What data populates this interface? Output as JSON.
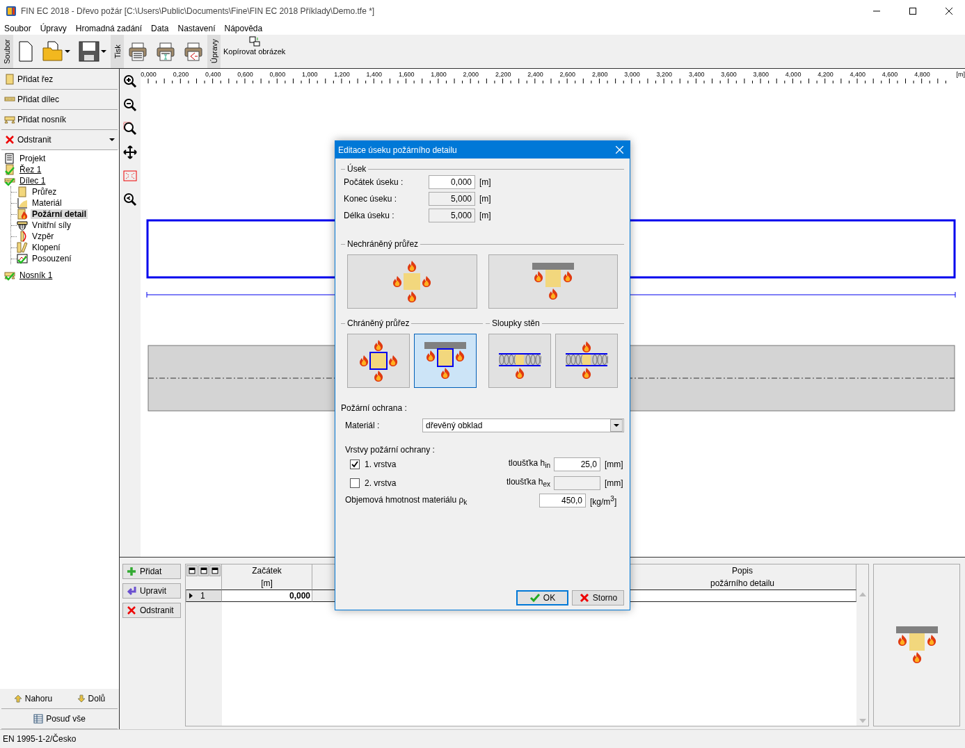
{
  "window": {
    "title": "FIN EC 2018 - Dřevo požár [C:\\Users\\Public\\Documents\\Fine\\FIN EC 2018 Příklady\\Demo.tfe *]"
  },
  "menu": [
    "Soubor",
    "Úpravy",
    "Hromadná zadání",
    "Data",
    "Nastavení",
    "Nápověda"
  ],
  "toolbar": {
    "groups": [
      {
        "kind": "file",
        "label": "Soubor"
      },
      {
        "kind": "print",
        "label": "Tisk"
      },
      {
        "kind": "edit",
        "label": "Úpravy",
        "button": "Kopírovat obrázek"
      }
    ]
  },
  "actions": [
    {
      "kind": "section",
      "label": "Přidat řez"
    },
    {
      "kind": "member",
      "label": "Přidat dílec"
    },
    {
      "kind": "beam",
      "label": "Přidat nosník"
    },
    {
      "kind": "remove",
      "label": "Odstranit"
    }
  ],
  "tree": [
    {
      "kind": "project",
      "label": "Projekt",
      "link": false,
      "ok": false,
      "selected": false
    },
    {
      "kind": "section",
      "label": "Řez 1",
      "link": true,
      "ok": true,
      "selected": false
    },
    {
      "kind": "member",
      "label": "Dílec 1",
      "link": true,
      "ok": true,
      "selected": false,
      "children": [
        {
          "kind": "cross-section",
          "label": "Průřez",
          "link": false,
          "ok": false,
          "selected": false
        },
        {
          "kind": "material",
          "label": "Materiál",
          "link": false,
          "ok": false,
          "selected": false
        },
        {
          "kind": "fire",
          "label": "Požární detail",
          "link": false,
          "ok": false,
          "selected": true
        },
        {
          "kind": "forces",
          "label": "Vnitřní síly",
          "link": false,
          "ok": false,
          "selected": false
        },
        {
          "kind": "buckling",
          "label": "Vzpěr",
          "link": false,
          "ok": false,
          "selected": false
        },
        {
          "kind": "lateral",
          "label": "Klopení",
          "link": false,
          "ok": false,
          "selected": false
        },
        {
          "kind": "check",
          "label": "Posouzení",
          "link": false,
          "ok": true,
          "selected": false
        }
      ]
    },
    {
      "kind": "beam",
      "label": "Nosník 1",
      "link": true,
      "ok": true,
      "selected": false
    }
  ],
  "left_footer": {
    "up": "Nahoru",
    "down": "Dolů",
    "check_all": "Posuď vše"
  },
  "ruler": {
    "labels": [
      "0,000",
      "0,200",
      "0,400",
      "0,600",
      "0,800",
      "1,000",
      "1,200",
      "1,400",
      "1,600",
      "1,800",
      "2,000",
      "2,200",
      "2,400",
      "2,600",
      "2,800",
      "3,000",
      "3,200",
      "3,400",
      "3,600",
      "3,800",
      "4,000",
      "4,200",
      "4,400",
      "4,600",
      "4,800"
    ],
    "unit": "[m]"
  },
  "table": {
    "buttons": [
      {
        "kind": "add",
        "label": "Přidat"
      },
      {
        "kind": "edit",
        "label": "Upravit"
      },
      {
        "kind": "remove",
        "label": "Odstranit"
      }
    ],
    "columns": [
      {
        "title": "Začátek",
        "subtitle": "[m]"
      },
      {
        "title": "Popis",
        "subtitle": "požárního detailu"
      }
    ],
    "rows": [
      {
        "number": "1",
        "start": "0,000"
      }
    ]
  },
  "status_bar": "EN 1995-1-2/Česko",
  "dialog": {
    "title": "Editace úseku požárního detailu",
    "segment": {
      "title": "Úsek",
      "fields": [
        {
          "label": "Počátek úseku :",
          "value": "0,000",
          "unit": "[m]",
          "editable": true
        },
        {
          "label": "Konec úseku :",
          "value": "5,000",
          "unit": "[m]",
          "editable": false
        },
        {
          "label": "Délka úseku :",
          "value": "5,000",
          "unit": "[m]",
          "editable": false
        }
      ]
    },
    "unprotected": {
      "title": "Nechráněný průřez",
      "options": [
        {
          "kind": "four-sided",
          "selected": false
        },
        {
          "kind": "three-sided",
          "selected": false
        }
      ]
    },
    "protected": {
      "title": "Chráněný průřez",
      "options": [
        {
          "kind": "protected-four-sided",
          "selected": false
        },
        {
          "kind": "protected-three-sided",
          "selected": true
        }
      ]
    },
    "wall_studs": {
      "title": "Sloupky stěn",
      "options": [
        {
          "kind": "wall-one-sided",
          "selected": false
        },
        {
          "kind": "wall-two-sided",
          "selected": false
        }
      ]
    },
    "protection": {
      "title": "Požární ochrana :",
      "material_label": "Materiál :",
      "material": "dřevěný obklad",
      "layers_title": "Vrstvy požární ochrany :",
      "layers": [
        {
          "label": "1. vrstva",
          "checked": true,
          "thickness_label": "tloušťka h$_{in}$",
          "unit": "[mm]",
          "value": "25,0"
        },
        {
          "label": "2. vrstva",
          "checked": false,
          "thickness_label": "tloušťka h$_{ex}$",
          "unit": "[mm]"
        }
      ],
      "density_label": "Objemová hmotnost materiálu ρ$_{k}$",
      "density": "450,0",
      "density_unit": "[kg/m$^{3}$]"
    },
    "buttons": [
      {
        "kind": "ok",
        "label": "OK"
      },
      {
        "kind": "cancel",
        "label": "Storno"
      }
    ]
  }
}
